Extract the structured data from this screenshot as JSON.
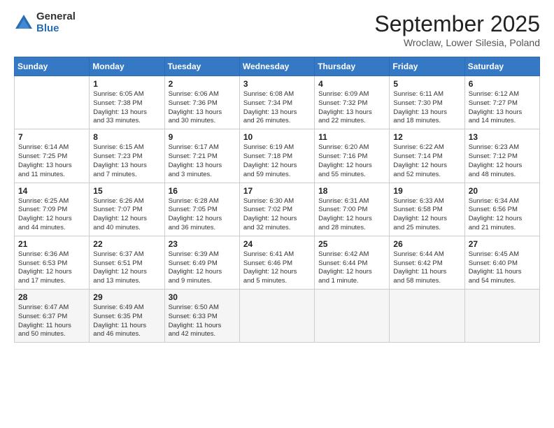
{
  "logo": {
    "general": "General",
    "blue": "Blue"
  },
  "title": "September 2025",
  "location": "Wroclaw, Lower Silesia, Poland",
  "days_header": [
    "Sunday",
    "Monday",
    "Tuesday",
    "Wednesday",
    "Thursday",
    "Friday",
    "Saturday"
  ],
  "weeks": [
    [
      {
        "day": "",
        "info": ""
      },
      {
        "day": "1",
        "info": "Sunrise: 6:05 AM\nSunset: 7:38 PM\nDaylight: 13 hours\nand 33 minutes."
      },
      {
        "day": "2",
        "info": "Sunrise: 6:06 AM\nSunset: 7:36 PM\nDaylight: 13 hours\nand 30 minutes."
      },
      {
        "day": "3",
        "info": "Sunrise: 6:08 AM\nSunset: 7:34 PM\nDaylight: 13 hours\nand 26 minutes."
      },
      {
        "day": "4",
        "info": "Sunrise: 6:09 AM\nSunset: 7:32 PM\nDaylight: 13 hours\nand 22 minutes."
      },
      {
        "day": "5",
        "info": "Sunrise: 6:11 AM\nSunset: 7:30 PM\nDaylight: 13 hours\nand 18 minutes."
      },
      {
        "day": "6",
        "info": "Sunrise: 6:12 AM\nSunset: 7:27 PM\nDaylight: 13 hours\nand 14 minutes."
      }
    ],
    [
      {
        "day": "7",
        "info": "Sunrise: 6:14 AM\nSunset: 7:25 PM\nDaylight: 13 hours\nand 11 minutes."
      },
      {
        "day": "8",
        "info": "Sunrise: 6:15 AM\nSunset: 7:23 PM\nDaylight: 13 hours\nand 7 minutes."
      },
      {
        "day": "9",
        "info": "Sunrise: 6:17 AM\nSunset: 7:21 PM\nDaylight: 13 hours\nand 3 minutes."
      },
      {
        "day": "10",
        "info": "Sunrise: 6:19 AM\nSunset: 7:18 PM\nDaylight: 12 hours\nand 59 minutes."
      },
      {
        "day": "11",
        "info": "Sunrise: 6:20 AM\nSunset: 7:16 PM\nDaylight: 12 hours\nand 55 minutes."
      },
      {
        "day": "12",
        "info": "Sunrise: 6:22 AM\nSunset: 7:14 PM\nDaylight: 12 hours\nand 52 minutes."
      },
      {
        "day": "13",
        "info": "Sunrise: 6:23 AM\nSunset: 7:12 PM\nDaylight: 12 hours\nand 48 minutes."
      }
    ],
    [
      {
        "day": "14",
        "info": "Sunrise: 6:25 AM\nSunset: 7:09 PM\nDaylight: 12 hours\nand 44 minutes."
      },
      {
        "day": "15",
        "info": "Sunrise: 6:26 AM\nSunset: 7:07 PM\nDaylight: 12 hours\nand 40 minutes."
      },
      {
        "day": "16",
        "info": "Sunrise: 6:28 AM\nSunset: 7:05 PM\nDaylight: 12 hours\nand 36 minutes."
      },
      {
        "day": "17",
        "info": "Sunrise: 6:30 AM\nSunset: 7:02 PM\nDaylight: 12 hours\nand 32 minutes."
      },
      {
        "day": "18",
        "info": "Sunrise: 6:31 AM\nSunset: 7:00 PM\nDaylight: 12 hours\nand 28 minutes."
      },
      {
        "day": "19",
        "info": "Sunrise: 6:33 AM\nSunset: 6:58 PM\nDaylight: 12 hours\nand 25 minutes."
      },
      {
        "day": "20",
        "info": "Sunrise: 6:34 AM\nSunset: 6:56 PM\nDaylight: 12 hours\nand 21 minutes."
      }
    ],
    [
      {
        "day": "21",
        "info": "Sunrise: 6:36 AM\nSunset: 6:53 PM\nDaylight: 12 hours\nand 17 minutes."
      },
      {
        "day": "22",
        "info": "Sunrise: 6:37 AM\nSunset: 6:51 PM\nDaylight: 12 hours\nand 13 minutes."
      },
      {
        "day": "23",
        "info": "Sunrise: 6:39 AM\nSunset: 6:49 PM\nDaylight: 12 hours\nand 9 minutes."
      },
      {
        "day": "24",
        "info": "Sunrise: 6:41 AM\nSunset: 6:46 PM\nDaylight: 12 hours\nand 5 minutes."
      },
      {
        "day": "25",
        "info": "Sunrise: 6:42 AM\nSunset: 6:44 PM\nDaylight: 12 hours\nand 1 minute."
      },
      {
        "day": "26",
        "info": "Sunrise: 6:44 AM\nSunset: 6:42 PM\nDaylight: 11 hours\nand 58 minutes."
      },
      {
        "day": "27",
        "info": "Sunrise: 6:45 AM\nSunset: 6:40 PM\nDaylight: 11 hours\nand 54 minutes."
      }
    ],
    [
      {
        "day": "28",
        "info": "Sunrise: 6:47 AM\nSunset: 6:37 PM\nDaylight: 11 hours\nand 50 minutes."
      },
      {
        "day": "29",
        "info": "Sunrise: 6:49 AM\nSunset: 6:35 PM\nDaylight: 11 hours\nand 46 minutes."
      },
      {
        "day": "30",
        "info": "Sunrise: 6:50 AM\nSunset: 6:33 PM\nDaylight: 11 hours\nand 42 minutes."
      },
      {
        "day": "",
        "info": ""
      },
      {
        "day": "",
        "info": ""
      },
      {
        "day": "",
        "info": ""
      },
      {
        "day": "",
        "info": ""
      }
    ]
  ]
}
